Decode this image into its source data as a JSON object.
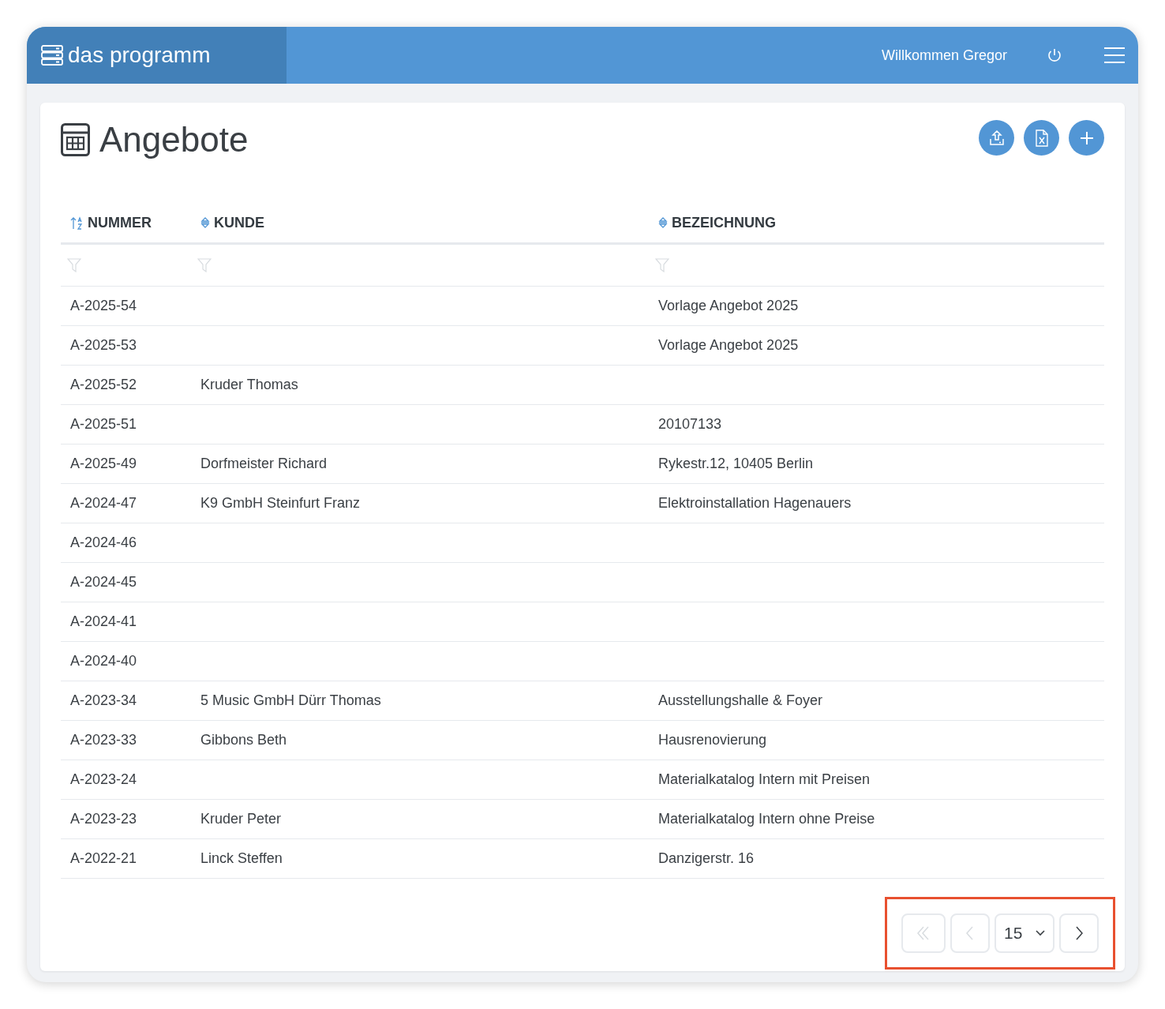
{
  "header": {
    "app_name": "das programm",
    "welcome": "Willkommen Gregor"
  },
  "page": {
    "title": "Angebote",
    "actions": [
      {
        "kind": "import"
      },
      {
        "kind": "excel"
      },
      {
        "kind": "add"
      }
    ]
  },
  "table": {
    "columns": [
      {
        "label": "NUMMER",
        "sorted": true
      },
      {
        "label": "KUNDE",
        "sorted": false
      },
      {
        "label": "BEZEICHNUNG",
        "sorted": false
      }
    ],
    "rows": [
      [
        "A-2025-54",
        "",
        "Vorlage Angebot 2025"
      ],
      [
        "A-2025-53",
        "",
        "Vorlage Angebot 2025"
      ],
      [
        "A-2025-52",
        "Kruder Thomas",
        ""
      ],
      [
        "A-2025-51",
        "",
        "20107133"
      ],
      [
        "A-2025-49",
        "Dorfmeister Richard",
        "Rykestr.12, 10405 Berlin"
      ],
      [
        "A-2024-47",
        "K9 GmbH Steinfurt Franz",
        "Elektroinstallation Hagenauers"
      ],
      [
        "A-2024-46",
        "",
        ""
      ],
      [
        "A-2024-45",
        "",
        ""
      ],
      [
        "A-2024-41",
        "",
        ""
      ],
      [
        "A-2024-40",
        "",
        ""
      ],
      [
        "A-2023-34",
        "5 Music GmbH Dürr Thomas",
        "Ausstellungshalle & Foyer"
      ],
      [
        "A-2023-33",
        "Gibbons Beth",
        "Hausrenovierung"
      ],
      [
        "A-2023-24",
        "",
        "Materialkatalog Intern mit Preisen"
      ],
      [
        "A-2023-23",
        "Kruder Peter",
        "Materialkatalog Intern ohne Preise"
      ],
      [
        "A-2022-21",
        "Linck Steffen",
        "Danzigerstr. 16"
      ]
    ]
  },
  "pagination": {
    "first": {
      "disabled": true
    },
    "previous": {
      "disabled": true
    },
    "page_size": "15",
    "next": {
      "disabled": false
    }
  }
}
